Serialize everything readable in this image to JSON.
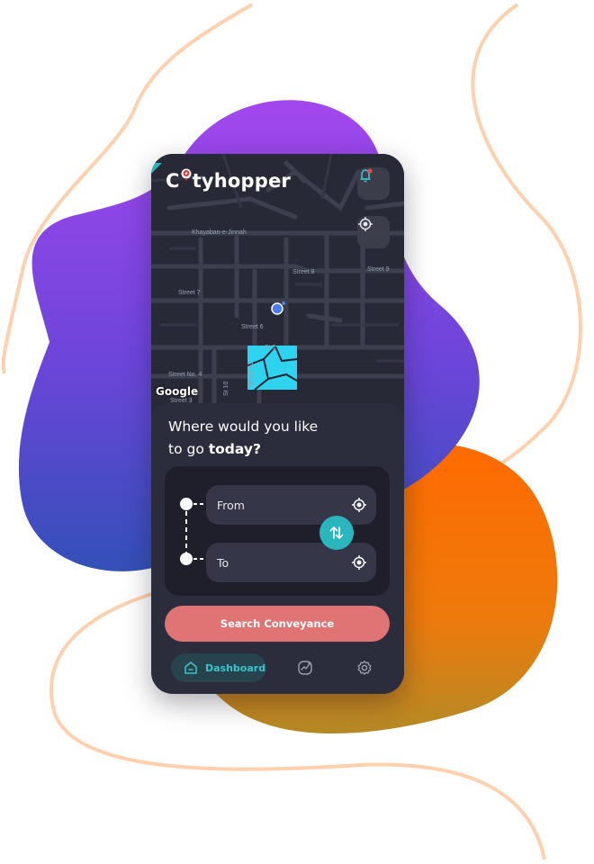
{
  "app": {
    "brand": "Cityhopper",
    "brand_prefix": "C",
    "brand_suffix": "tyhopper"
  },
  "map": {
    "attribution": "Google",
    "streets": [
      "Khayaban-e-Jinnah",
      "Street 8",
      "Street 9",
      "Street 7",
      "Street 6",
      "St 5",
      "Street No. 4",
      "Street 3",
      "St 10",
      "Street 11"
    ]
  },
  "sheet": {
    "headline_line1": "Where would you like",
    "headline_line2_prefix": "to go ",
    "headline_line2_bold": "today?",
    "from_placeholder": "From",
    "to_placeholder": "To",
    "search_label": "Search Conveyance"
  },
  "nav": {
    "items": [
      {
        "label": "Dashboard",
        "icon": "home-icon",
        "active": true
      },
      {
        "label": "",
        "icon": "stats-icon",
        "active": false
      },
      {
        "label": "",
        "icon": "settings-icon",
        "active": false
      }
    ]
  },
  "colors": {
    "accent": "#2bb5bd",
    "cta": "#e07373",
    "surface": "#2b2c3c",
    "map_highlight": "#2ed3ef"
  }
}
